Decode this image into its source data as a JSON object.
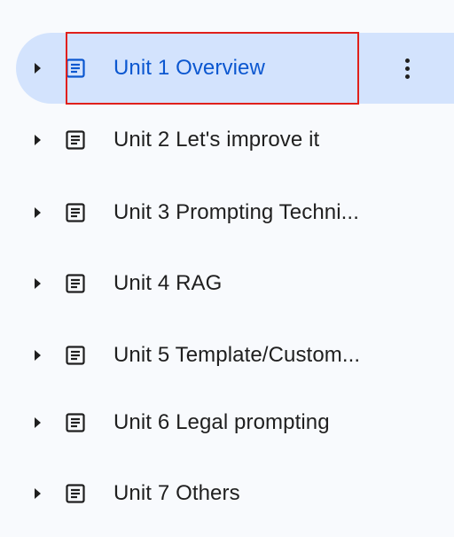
{
  "outline": {
    "items": [
      {
        "label": "Unit 1 Overview",
        "selected": true,
        "icon": "document-icon"
      },
      {
        "label": "Unit 2 Let's improve it",
        "selected": false,
        "icon": "document-icon"
      },
      {
        "label": "Unit 3 Prompting Techni...",
        "selected": false,
        "icon": "document-icon"
      },
      {
        "label": "Unit 4 RAG",
        "selected": false,
        "icon": "document-icon"
      },
      {
        "label": "Unit 5 Template/Custom...",
        "selected": false,
        "icon": "document-icon"
      },
      {
        "label": "Unit 6 Legal prompting",
        "selected": false,
        "icon": "document-icon"
      },
      {
        "label": "Unit 7 Others",
        "selected": false,
        "icon": "document-icon"
      }
    ],
    "more_icon": "more-vert-icon",
    "expand_icon": "caret-right-icon"
  },
  "colors": {
    "background": "#f8fafd",
    "selected_background": "#d3e3fd",
    "selected_text": "#0b57d0",
    "text": "#1f1f1f",
    "highlight_border": "#e0201b"
  }
}
